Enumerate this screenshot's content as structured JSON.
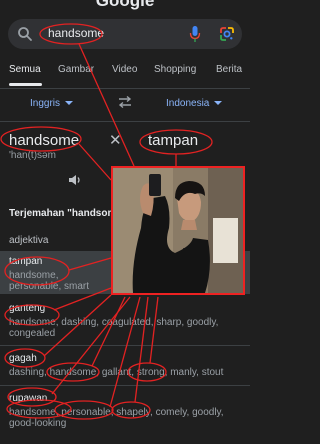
{
  "header": {
    "logo_text": "Google"
  },
  "search": {
    "query": "handsome"
  },
  "tabs": [
    "Semua",
    "Gambar",
    "Video",
    "Shopping",
    "Berita"
  ],
  "translator": {
    "source_lang": "Inggris",
    "target_lang": "Indonesia",
    "source_word": "handsome",
    "pronunciation": "'han(t)səm",
    "target_word": "tampan",
    "translations_heading": "Terjemahan \"handsome\"",
    "part_of_speech": "adjektiva",
    "entries": [
      {
        "word": "tampan",
        "synonyms": "handsome, personable, smart"
      },
      {
        "word": "ganteng",
        "synonyms": "handsome, dashing, coagulated, sharp, goodly, congealed"
      },
      {
        "word": "gagah",
        "synonyms": "dashing, handsome, gallant, strong, manly, stout"
      },
      {
        "word": "rupawan",
        "synonyms": "handsome, personable, shapely, comely, goodly, good-looking"
      }
    ]
  },
  "colors": {
    "background": "#1f1f1f",
    "link": "#8ab4f8",
    "annotation": "#e22222"
  },
  "icons": {
    "search": "search-icon",
    "mic": "microphone-icon",
    "lens": "google-lens-icon",
    "swap": "swap-languages-icon",
    "close": "close-icon",
    "speaker": "speaker-icon"
  }
}
